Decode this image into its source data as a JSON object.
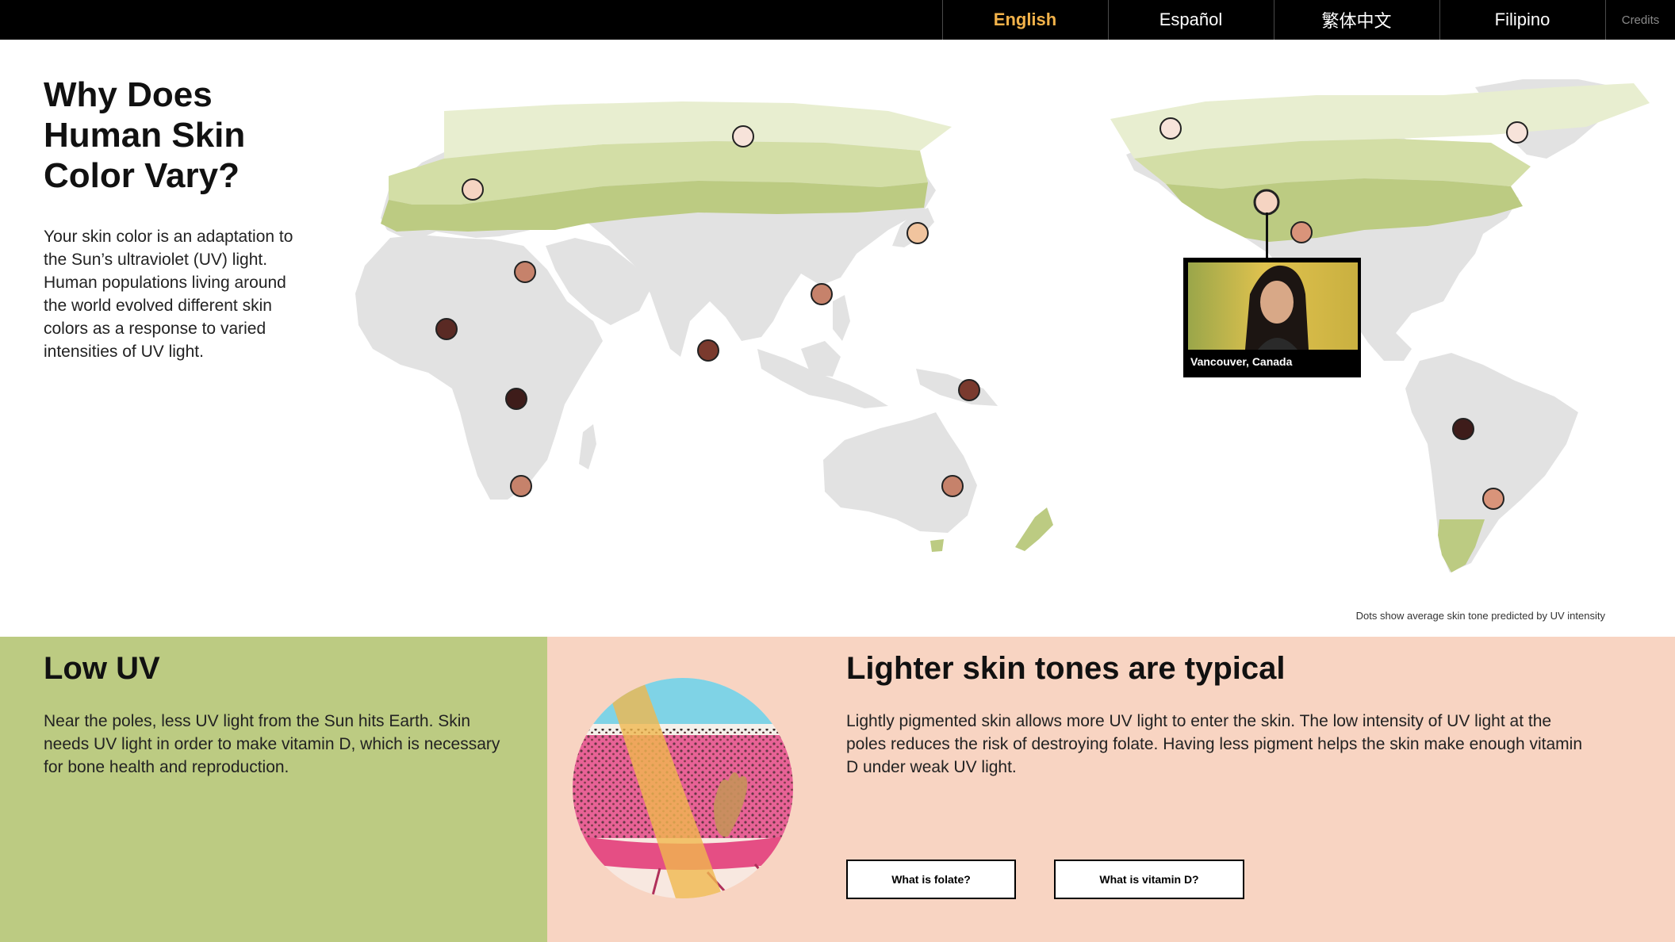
{
  "nav": {
    "languages": [
      {
        "label": "English",
        "active": true
      },
      {
        "label": "Español",
        "active": false
      },
      {
        "label": "繁体中文",
        "active": false
      },
      {
        "label": "Filipino",
        "active": false
      }
    ],
    "credits_label": "Credits"
  },
  "intro": {
    "title": "Why Does Human Skin Color Vary?",
    "body": "Your skin color is an adaptation to the Sun’s ultraviolet (UV) light. Human populations living around the world evolved different skin colors as a response to varied intensities of UV light."
  },
  "map": {
    "caption": "Dots show average skin tone predicted by UV intensity",
    "callout_location": "Vancouver, Canada",
    "colors": {
      "land": "#e2e2e2",
      "low_uv_dark": "#bccb82",
      "low_uv_mid": "#d3dea6",
      "low_uv_light": "#e8eed0"
    },
    "tones": [
      "#f7e3da",
      "#f5d4c2",
      "#f1c49e",
      "#d9947a",
      "#c6826b",
      "#9b5546",
      "#7a3a2e",
      "#5a2a24",
      "#3e1c1a"
    ]
  },
  "low_uv": {
    "title": "Low UV",
    "body": "Near the poles, less UV light from the Sun hits Earth. Skin needs UV light in order to make vitamin D, which is necessary for bone health and reproduction."
  },
  "typical": {
    "title": "Lighter skin tones are typical",
    "body": "Lightly pigmented skin allows more UV light to enter the skin. The low intensity of UV light at the poles reduces the risk of destroying folate. Having less pigment helps the skin make enough vitamin D under weak UV light.",
    "buttons": {
      "folate": "What is folate?",
      "vitamin_d": "What is vitamin D?"
    },
    "colors": {
      "panel": "#f8d4c2",
      "sky": "#7fd3e6",
      "uv_beam": "#f0b84f",
      "skin": "#e86296"
    }
  }
}
